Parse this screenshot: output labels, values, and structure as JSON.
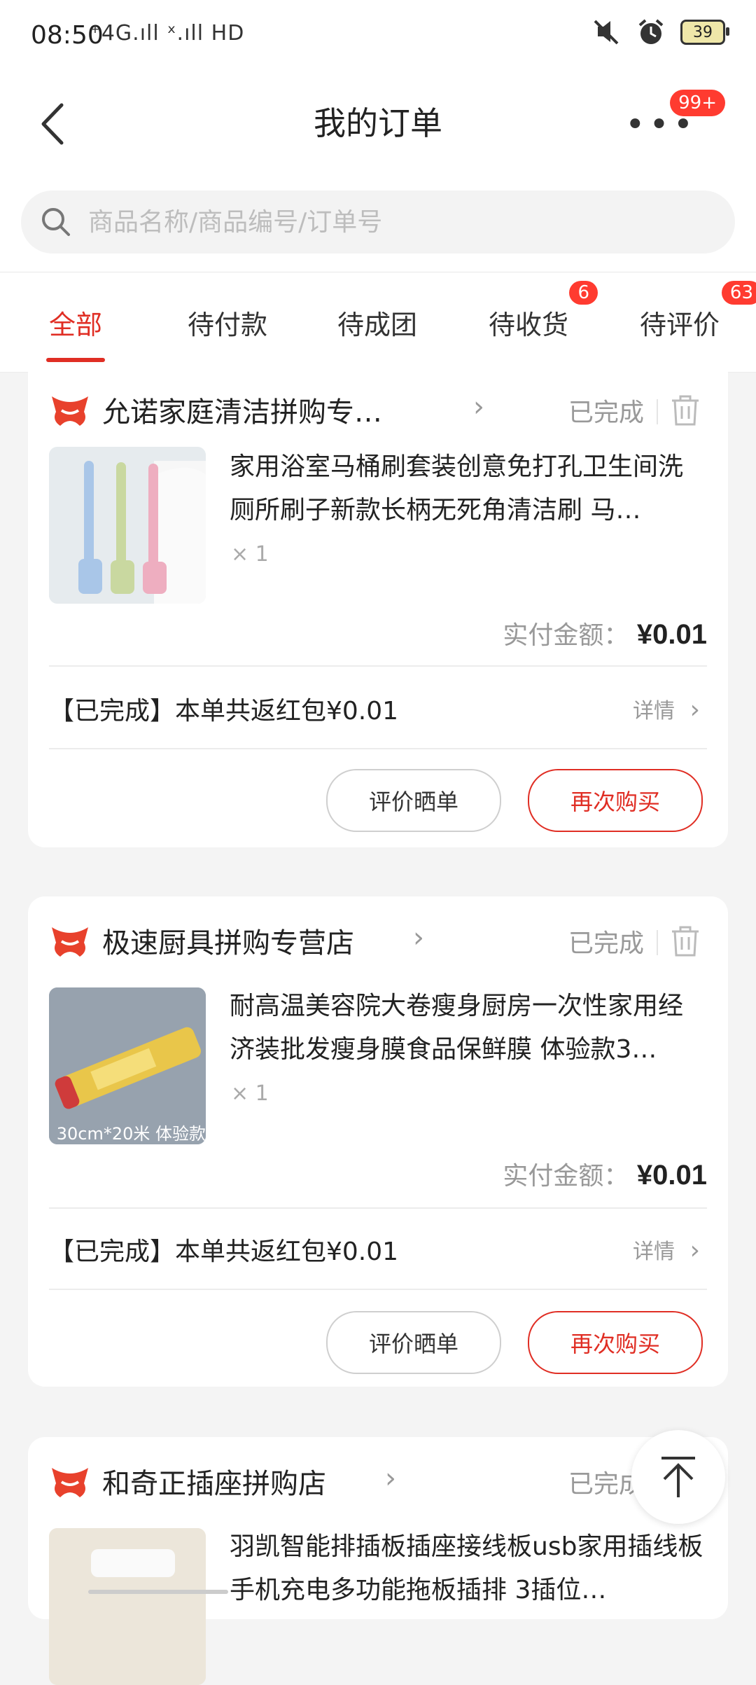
{
  "status_bar": {
    "time": "08:50",
    "network": "⁺4G.ıll ˣ.ıll HD",
    "battery": "39"
  },
  "header": {
    "title": "我的订单",
    "more_badge": "99+"
  },
  "search": {
    "placeholder": "商品名称/商品编号/订单号"
  },
  "tabs": [
    {
      "label": "全部",
      "active": true
    },
    {
      "label": "待付款"
    },
    {
      "label": "待成团"
    },
    {
      "label": "待收货",
      "badge": "6"
    },
    {
      "label": "待评价",
      "badge": "63"
    }
  ],
  "orders": [
    {
      "shop": "允诺家庭清洁拼购专…",
      "status": "已完成",
      "product_title": "家用浴室马桶刷套装创意免打孔卫生间洗厕所刷子新款长柄无死角清洁刷 马…",
      "quantity": "× 1",
      "paid_label": "实付金额：",
      "paid_amount": "¥0.01",
      "rebate": "【已完成】本单共返红包¥0.01",
      "detail": "详情",
      "review_button": "评价晒单",
      "rebuy_button": "再次购买"
    },
    {
      "shop": "极速厨具拼购专营店",
      "status": "已完成",
      "product_title": "耐高温美容院大卷瘦身厨房一次性家用经济装批发瘦身膜食品保鲜膜 体验款3…",
      "thumb_caption": "30cm*20米 体验款",
      "quantity": "× 1",
      "paid_label": "实付金额：",
      "paid_amount": "¥0.01",
      "rebate": "【已完成】本单共返红包¥0.01",
      "detail": "详情",
      "review_button": "评价晒单",
      "rebuy_button": "再次购买"
    },
    {
      "shop": "和奇正插座拼购店",
      "status": "已完成",
      "product_title": "羽凯智能排插板插座接线板usb家用插线板手机充电多功能拖板插排 3插位…"
    }
  ],
  "colors": {
    "accent": "#e02e24",
    "badge": "#ff3b30"
  }
}
